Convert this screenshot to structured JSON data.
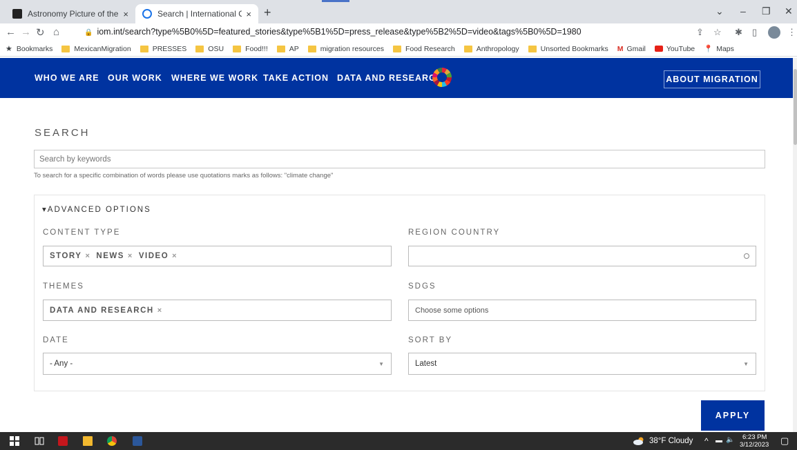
{
  "browser": {
    "tabs": [
      {
        "title": "Astronomy Picture of the Day",
        "close": "×"
      },
      {
        "title": "Search | International Organizatio",
        "close": "×"
      }
    ],
    "new_tab": "+",
    "url": "iom.int/search?type%5B0%5D=featured_stories&type%5B1%5D=press_release&type%5B2%5D=video&tags%5B0%5D=1980",
    "bookmarks": [
      "Bookmarks",
      "MexicanMigration",
      "PRESSES",
      "OSU",
      "Food!!!",
      "AP",
      "migration resources",
      "Food Research",
      "Anthropology",
      "Unsorted Bookmarks",
      "Gmail",
      "YouTube",
      "Maps"
    ]
  },
  "site_nav": {
    "links": [
      "WHO WE ARE",
      "OUR WORK",
      "WHERE WE WORK",
      "TAKE ACTION",
      "DATA AND RESEARCH"
    ],
    "about": "ABOUT MIGRATION"
  },
  "search": {
    "heading": "SEARCH",
    "placeholder": "Search by keywords",
    "hint": "To search for a specific combination of words please use quotations marks as follows: \"climate change\""
  },
  "advanced": {
    "toggle": "▾ADVANCED OPTIONS",
    "content_type_label": "CONTENT TYPE",
    "content_type_chips": [
      "STORY",
      "NEWS",
      "VIDEO"
    ],
    "region_label": "REGION COUNTRY",
    "themes_label": "THEMES",
    "themes_chips": [
      "DATA AND RESEARCH"
    ],
    "sdgs_label": "SDGS",
    "sdgs_placeholder": "Choose some options",
    "date_label": "DATE",
    "date_value": "- Any -",
    "sort_label": "SORT BY",
    "sort_value": "Latest",
    "chip_remove": "×"
  },
  "apply": "APPLY",
  "taskbar": {
    "weather": "38°F  Cloudy",
    "time": "6:23 PM",
    "date": "3/12/2023"
  }
}
